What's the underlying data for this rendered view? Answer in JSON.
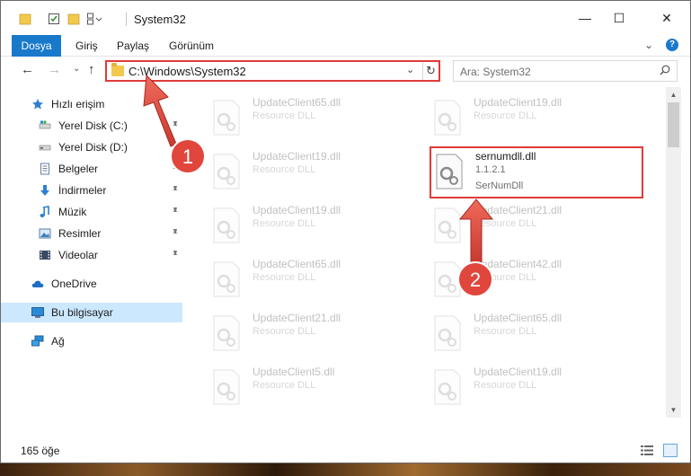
{
  "window": {
    "title": "System32",
    "controls": {
      "minimize": "—",
      "maximize": "☐",
      "close": "✕"
    }
  },
  "ribbon": {
    "tabs": [
      "Dosya",
      "Giriş",
      "Paylaş",
      "Görünüm"
    ],
    "help": "?"
  },
  "address_bar": {
    "path": "C:\\Windows\\System32",
    "search_placeholder": "Ara: System32"
  },
  "nav_pane": {
    "items": [
      {
        "label": "Hızlı erişim",
        "icon": "star-icon",
        "pinned": false
      },
      {
        "label": "Yerel Disk (C:)",
        "icon": "drive-icon",
        "pinned": true
      },
      {
        "label": "Yerel Disk (D:)",
        "icon": "drive-icon",
        "pinned": true
      },
      {
        "label": "Belgeler",
        "icon": "documents-icon",
        "pinned": true
      },
      {
        "label": "İndirmeler",
        "icon": "download-icon",
        "pinned": true
      },
      {
        "label": "Müzik",
        "icon": "music-icon",
        "pinned": true
      },
      {
        "label": "Resimler",
        "icon": "pictures-icon",
        "pinned": true
      },
      {
        "label": "Videolar",
        "icon": "videos-icon",
        "pinned": true
      },
      {
        "label": "OneDrive",
        "icon": "cloud-icon",
        "pinned": false
      },
      {
        "label": "Bu bilgisayar",
        "icon": "computer-icon",
        "pinned": false
      },
      {
        "label": "Ağ",
        "icon": "network-icon",
        "pinned": false
      }
    ]
  },
  "files": {
    "left": [
      {
        "name": "UpdateClient65.dll",
        "desc": "Resource DLL"
      },
      {
        "name": "UpdateClient19.dll",
        "desc": "Resource DLL"
      },
      {
        "name": "UpdateClient19.dll",
        "desc": "Resource DLL"
      },
      {
        "name": "UpdateClient65.dll",
        "desc": "Resource DLL"
      },
      {
        "name": "UpdateClient21.dll",
        "desc": "Resource DLL"
      },
      {
        "name": "UpdateClient5.dll",
        "desc": "Resource DLL"
      }
    ],
    "right": [
      {
        "name": "UpdateClient19.dll",
        "desc": "Resource DLL"
      },
      {
        "name": "UpdateClient21.dll",
        "desc": "Resource DLL"
      },
      {
        "name": "UpdateClient42.dll",
        "desc": "Resource DLL"
      },
      {
        "name": "UpdateClient65.dll",
        "desc": "Resource DLL"
      },
      {
        "name": "UpdateClient19.dll",
        "desc": "Resource DLL"
      }
    ],
    "highlighted": {
      "name": "sernumdll.dll",
      "version": "1.1.2.1",
      "desc": "SerNumDll"
    }
  },
  "status": {
    "item_count": "165 öğe"
  },
  "annotations": {
    "step1": "1",
    "step2": "2",
    "arrow_color": "#e0463c"
  },
  "colors": {
    "accent": "#1979ca",
    "highlight": "#e03a3a",
    "selected": "#cce8ff"
  }
}
